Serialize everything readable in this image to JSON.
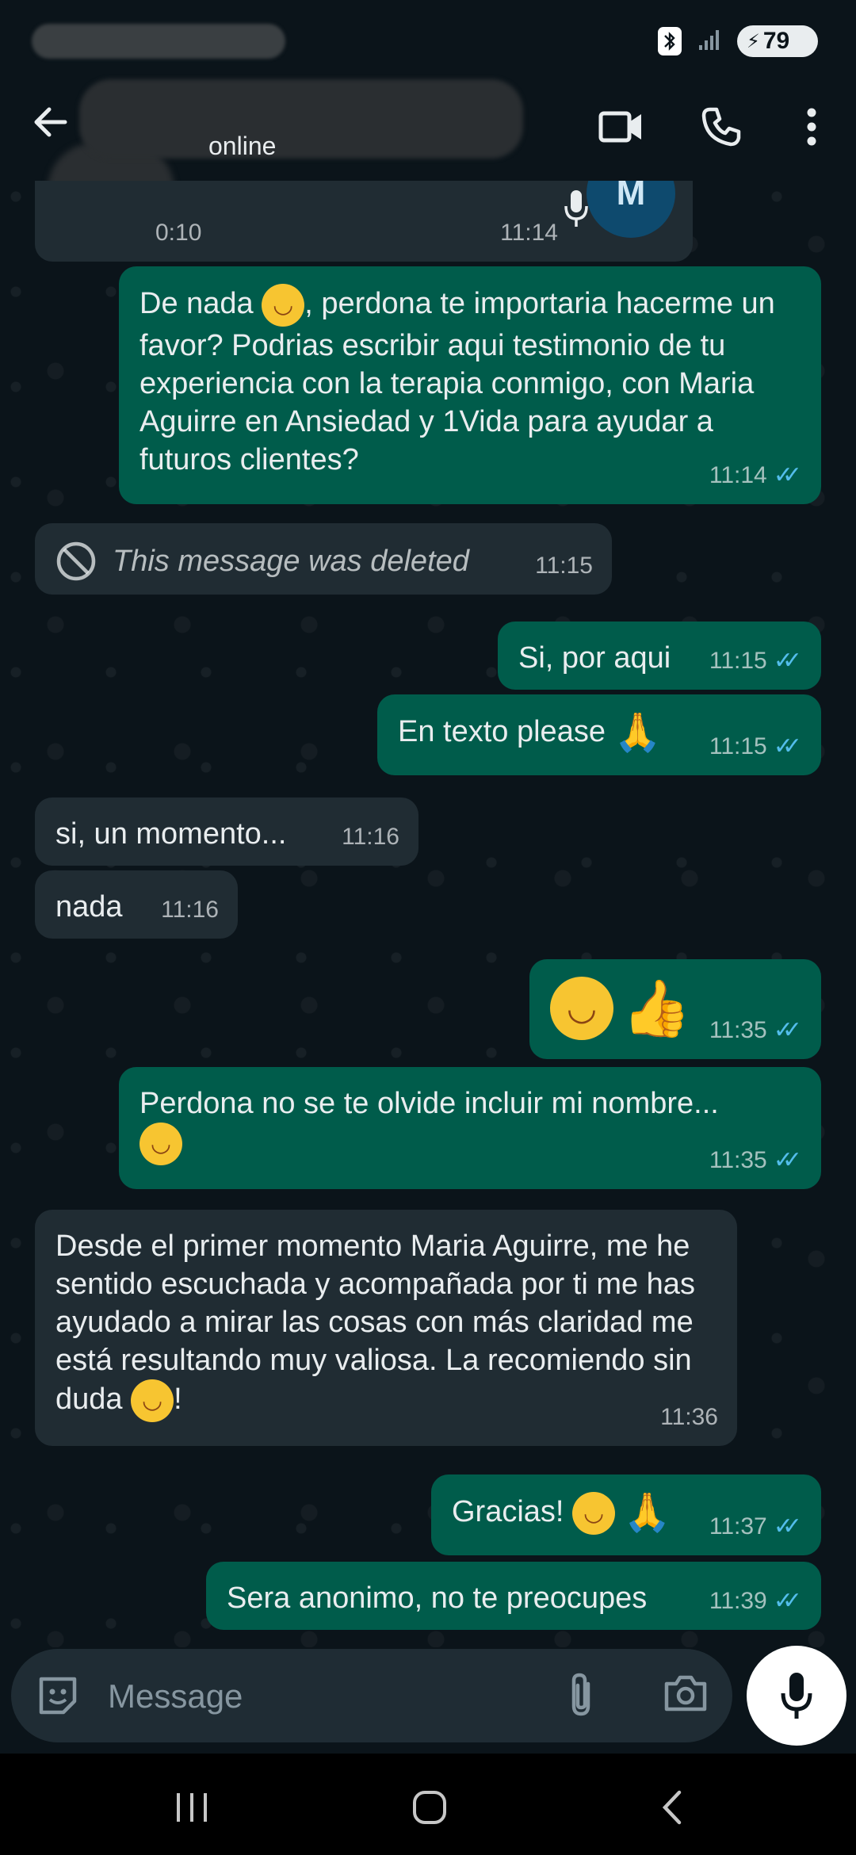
{
  "status_bar": {
    "battery": "79"
  },
  "header": {
    "status": "online"
  },
  "messages": {
    "voice": {
      "duration": "0:10",
      "time": "11:14",
      "avatar_letter": "M"
    },
    "m1": {
      "text": "De nada",
      "text2": ", perdona te importaria hacerme un favor? Podrias escribir aqui testimonio de tu experiencia con la terapia conmigo, con Maria Aguirre en Ansiedad y 1Vida para ayudar a futuros clientes?",
      "time": "11:14"
    },
    "m2": {
      "text": "This message was deleted",
      "time": "11:15"
    },
    "m3": {
      "text": "Si, por aqui",
      "time": "11:15"
    },
    "m4": {
      "text": "En texto please",
      "time": "11:15"
    },
    "m5": {
      "text": "si, un momento...",
      "time": "11:16"
    },
    "m6": {
      "text": "nada",
      "time": "11:16"
    },
    "m7": {
      "time": "11:35"
    },
    "m8": {
      "text": "Perdona no se te olvide incluir mi nombre...",
      "time": "11:35"
    },
    "m9": {
      "text": "Desde el primer momento Maria Aguirre,  me he sentido escuchada y acompañada por ti me has ayudado a mirar las cosas con más claridad me está resultando muy valiosa. La recomiendo sin duda",
      "text_end": "!",
      "time": "11:36"
    },
    "m10": {
      "text": "Gracias!",
      "time": "11:37"
    },
    "m11": {
      "text": "Sera anonimo, no te preocupes",
      "time": "11:39"
    }
  },
  "composer": {
    "placeholder": "Message"
  },
  "colors": {
    "outgoing": "#005c4b",
    "incoming": "#202c33",
    "read_ticks": "#53bdeb",
    "background": "#0b141a"
  }
}
